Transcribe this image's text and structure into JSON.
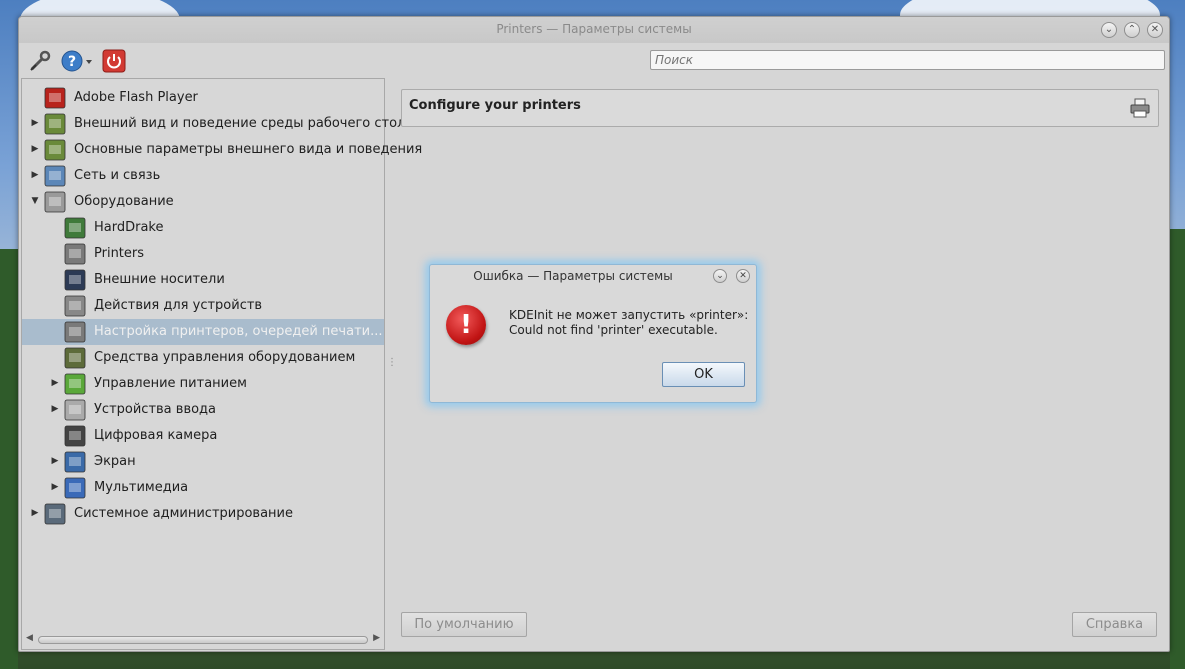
{
  "window": {
    "title": "Printers — Параметры системы"
  },
  "toolbar": {
    "search_placeholder": "Поиск",
    "icons": [
      "tools-icon",
      "help-icon",
      "power-icon"
    ]
  },
  "sidebar": {
    "items": [
      {
        "label": "Adobe Flash Player",
        "icon": "flash-icon",
        "expander": "",
        "selected": false
      },
      {
        "label": "Внешний вид и поведение среды рабочего стола",
        "icon": "appearance-icon",
        "expander": "▶",
        "selected": false
      },
      {
        "label": "Основные параметры внешнего вида и поведения",
        "icon": "appearance-icon",
        "expander": "▶",
        "selected": false
      },
      {
        "label": "Сеть и связь",
        "icon": "network-icon",
        "expander": "▶",
        "selected": false
      },
      {
        "label": "Оборудование",
        "icon": "hardware-icon",
        "expander": "▼",
        "selected": false
      },
      {
        "label": "HardDrake",
        "icon": "harddrake-icon",
        "expander": "",
        "selected": false
      },
      {
        "label": "Printers",
        "icon": "printer-icon",
        "expander": "",
        "selected": false
      },
      {
        "label": "Внешние носители",
        "icon": "removable-icon",
        "expander": "",
        "selected": false
      },
      {
        "label": "Действия для устройств",
        "icon": "gears-icon",
        "expander": "",
        "selected": false
      },
      {
        "label": "Настройка принтеров, очередей печати...",
        "icon": "printer-icon",
        "expander": "",
        "selected": true
      },
      {
        "label": "Средства управления оборудованием",
        "icon": "hardware-tools-icon",
        "expander": "",
        "selected": false
      },
      {
        "label": "Управление питанием",
        "icon": "battery-icon",
        "expander": "▶",
        "selected": false
      },
      {
        "label": "Устройства ввода",
        "icon": "keyboard-icon",
        "expander": "▶",
        "selected": false
      },
      {
        "label": "Цифровая камера",
        "icon": "camera-icon",
        "expander": "",
        "selected": false
      },
      {
        "label": "Экран",
        "icon": "display-icon",
        "expander": "▶",
        "selected": false
      },
      {
        "label": "Мультимедиа",
        "icon": "multimedia-icon",
        "expander": "▶",
        "selected": false
      },
      {
        "label": "Системное администрирование",
        "icon": "admin-icon",
        "expander": "▶",
        "selected": false
      }
    ]
  },
  "content": {
    "header_title": "Configure your printers",
    "default_button": "По умолчанию",
    "help_button": "Справка"
  },
  "dialog": {
    "title": "Ошибка — Параметры системы",
    "message_line1": "KDEInit не может запустить «printer»:",
    "message_line2": "Could not find 'printer' executable.",
    "ok_button": "OK"
  },
  "colors": {
    "selection": "#a9bccd",
    "error_red": "#c11414",
    "dialog_glow": "#8cc8f0"
  }
}
